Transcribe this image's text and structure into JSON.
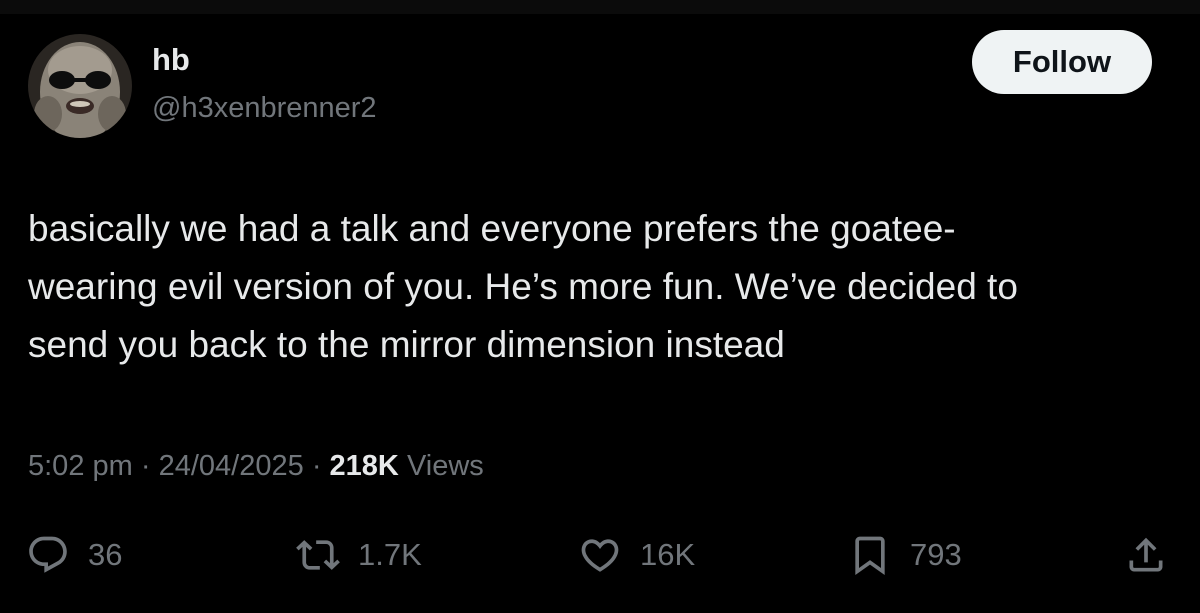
{
  "author": {
    "display_name": "hb",
    "handle": "@h3xenbrenner2"
  },
  "follow_label": "Follow",
  "tweet": {
    "lines": [
      "basically we had a talk and everyone prefers the goatee-",
      "wearing evil version of you. He’s more fun. We’ve decided to",
      "send you back to the mirror dimension instead"
    ]
  },
  "meta": {
    "time": "5:02 pm",
    "separator": "·",
    "date": "24/04/2025",
    "views_count": "218K",
    "views_label": "Views"
  },
  "actions": {
    "replies": "36",
    "reposts": "1.7K",
    "likes": "16K",
    "bookmarks": "793"
  },
  "icons": {
    "reply": "reply-icon",
    "repost": "repost-icon",
    "like": "heart-icon",
    "bookmark": "bookmark-icon",
    "share": "share-icon"
  },
  "colors": {
    "background": "#000000",
    "text_primary": "#e7e9ea",
    "text_secondary": "#71767b",
    "follow_bg": "#eff3f4",
    "follow_text": "#0f1419"
  }
}
